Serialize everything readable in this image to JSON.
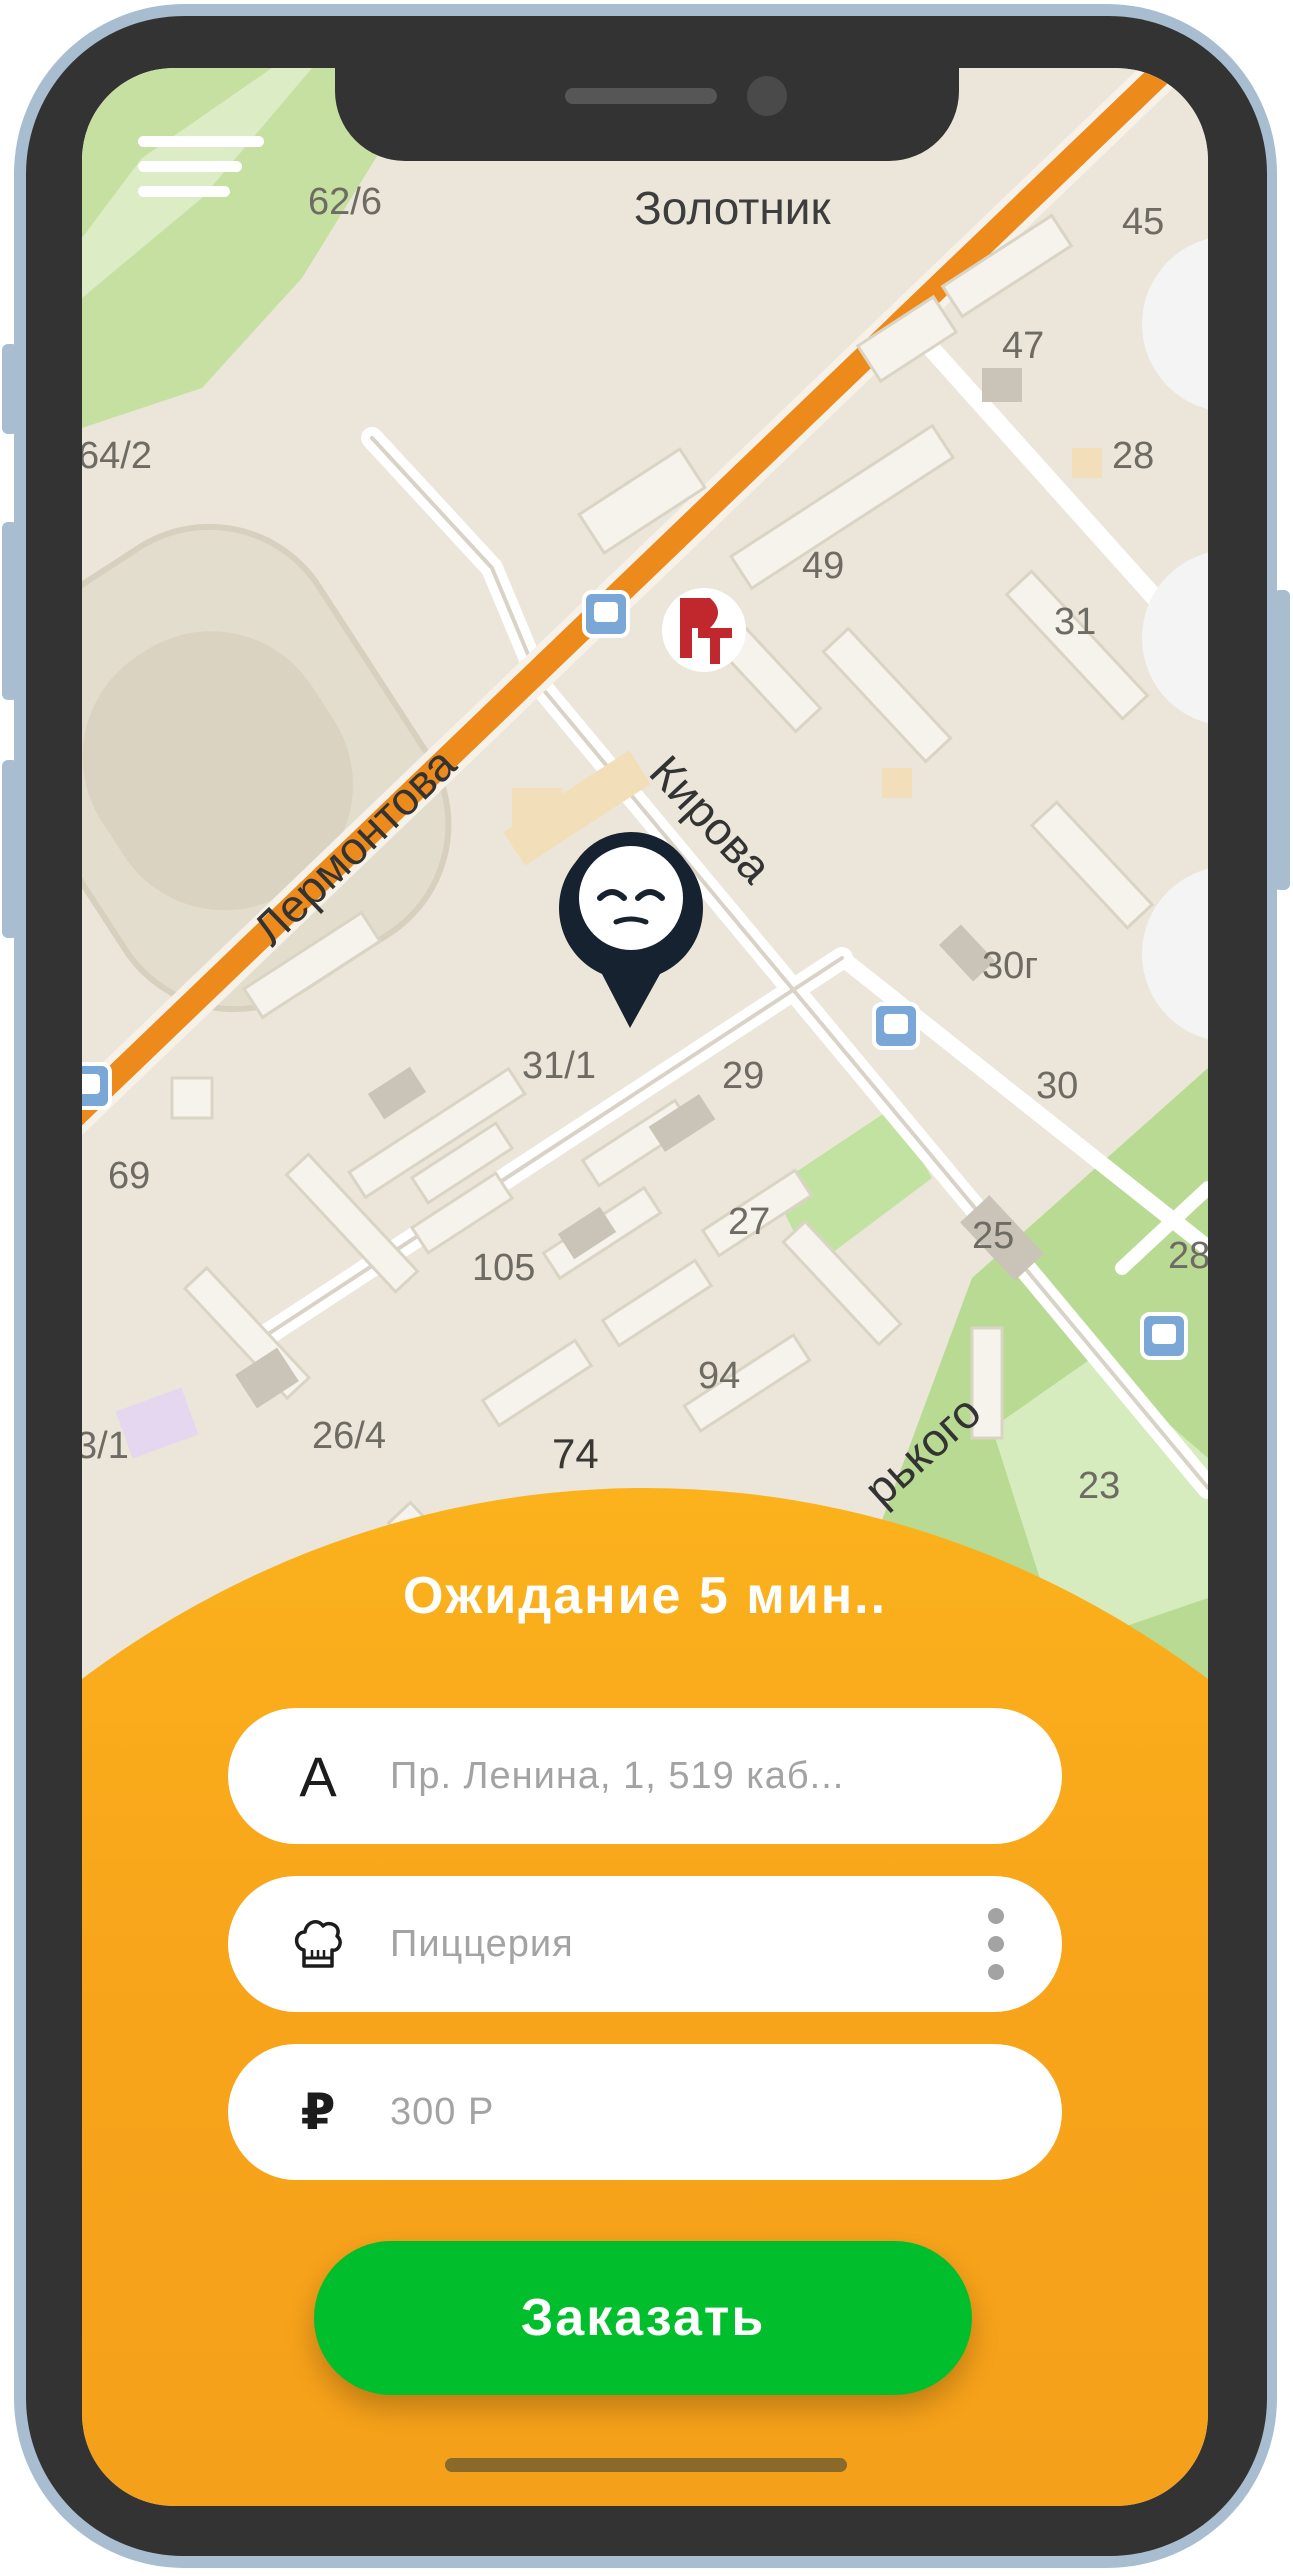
{
  "map": {
    "streets": {
      "lermontova": "Лермонтова",
      "kirova": "Кирова",
      "gorkogo": "рького"
    },
    "poi_label": "Золотник",
    "house_numbers": [
      "62/6",
      "45",
      "47",
      "28",
      "64/2",
      "49",
      "31",
      "30г",
      "31/1",
      "29",
      "30",
      "69",
      "27",
      "25",
      "105",
      "94",
      "26/4",
      "74",
      "23",
      "3/1",
      "28"
    ]
  },
  "status": {
    "waiting_text": "Ожидание 5 мин.."
  },
  "form": {
    "address": {
      "icon_letter": "A",
      "value": "Пр. Ленина, 1, 519 каб..."
    },
    "restaurant": {
      "value": "Пиццерия"
    },
    "price": {
      "icon_symbol": "₽",
      "value": "300 Р"
    }
  },
  "actions": {
    "order_label": "Заказать"
  },
  "colors": {
    "accent_orange": "#fbb21c",
    "order_green": "#01bf2c",
    "frame": "#a8bdd0",
    "bezel": "#333333",
    "road_orange": "#ec8a1c",
    "pin": "#16222f"
  },
  "icons": [
    "menu-icon",
    "chef-hat-icon",
    "more-vertical-icon",
    "ruble-icon",
    "bus-stop-icon",
    "map-pin-icon"
  ]
}
